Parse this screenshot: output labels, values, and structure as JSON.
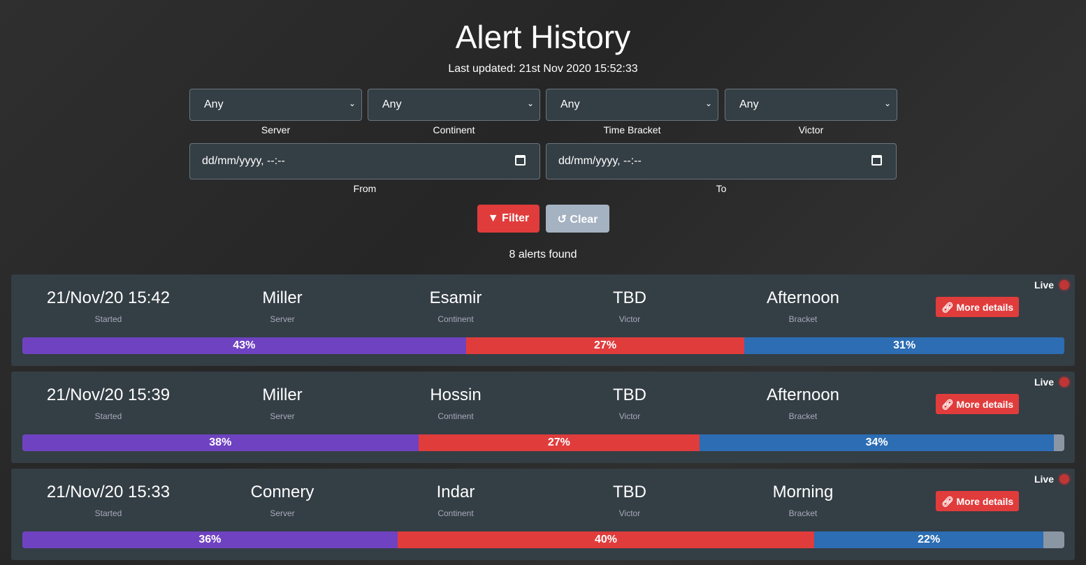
{
  "title": "Alert History",
  "last_updated": "Last updated: 21st Nov 2020 15:52:33",
  "filters": [
    {
      "value": "Any",
      "label": "Server"
    },
    {
      "value": "Any",
      "label": "Continent"
    },
    {
      "value": "Any",
      "label": "Time Bracket"
    },
    {
      "value": "Any",
      "label": "Victor"
    }
  ],
  "dates": [
    {
      "placeholder": "dd/mm/yyyy, --:--",
      "label": "From"
    },
    {
      "placeholder": "dd/mm/yyyy, --:--",
      "label": "To"
    }
  ],
  "filter_label": "Filter",
  "clear_label": "Clear",
  "found": "8 alerts found",
  "colors": {
    "purple": "#6f42c1",
    "red": "#e03c3c",
    "blue": "#2c6db4"
  },
  "labels": {
    "started": "Started",
    "server": "Server",
    "continent": "Continent",
    "victor": "Victor",
    "bracket": "Bracket",
    "live": "Live",
    "more": "More details"
  },
  "alerts": [
    {
      "started": "21/Nov/20 15:42",
      "server": "Miller",
      "continent": "Esamir",
      "victor": "TBD",
      "bracket": "Afternoon",
      "pct": [
        43,
        27,
        31
      ]
    },
    {
      "started": "21/Nov/20 15:39",
      "server": "Miller",
      "continent": "Hossin",
      "victor": "TBD",
      "bracket": "Afternoon",
      "pct": [
        38,
        27,
        34
      ]
    },
    {
      "started": "21/Nov/20 15:33",
      "server": "Connery",
      "continent": "Indar",
      "victor": "TBD",
      "bracket": "Morning",
      "pct": [
        36,
        40,
        22
      ]
    }
  ]
}
